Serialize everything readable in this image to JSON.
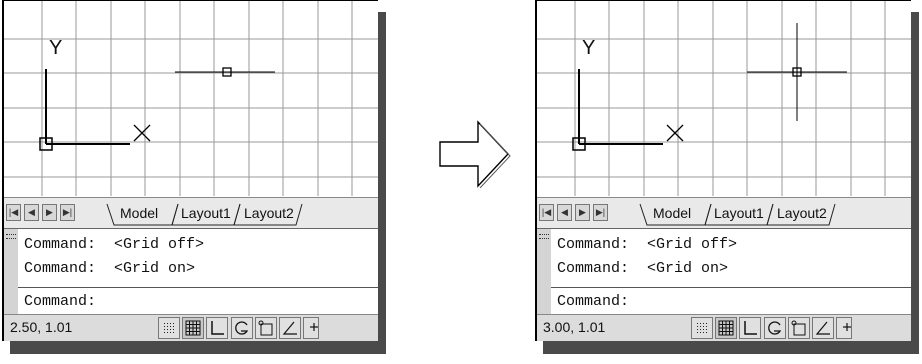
{
  "panels": [
    {
      "ucs_y_label": "Y",
      "tabs": {
        "model": "Model",
        "layout1": "Layout1",
        "layout2": "Layout2"
      },
      "command_history": [
        {
          "prompt": "Command:",
          "message": "<Grid off>"
        },
        {
          "prompt": "Command:",
          "message": "<Grid on>"
        }
      ],
      "command_prompt": "Command:",
      "coordinates": "2.50, 1.01"
    },
    {
      "ucs_y_label": "Y",
      "tabs": {
        "model": "Model",
        "layout1": "Layout1",
        "layout2": "Layout2"
      },
      "command_history": [
        {
          "prompt": "Command:",
          "message": "<Grid off>"
        },
        {
          "prompt": "Command:",
          "message": "<Grid on>"
        }
      ],
      "command_prompt": "Command:",
      "coordinates": "3.00, 1.01"
    }
  ],
  "status_icons": [
    "snap-icon",
    "grid-icon",
    "ortho-icon",
    "polar-icon",
    "osnap-icon",
    "otrack-icon",
    "lwt-icon"
  ],
  "colors": {
    "grid_line": "#9a9a9a",
    "shadow": "#4a4a4a",
    "status_bar": "#dcdcdc"
  }
}
